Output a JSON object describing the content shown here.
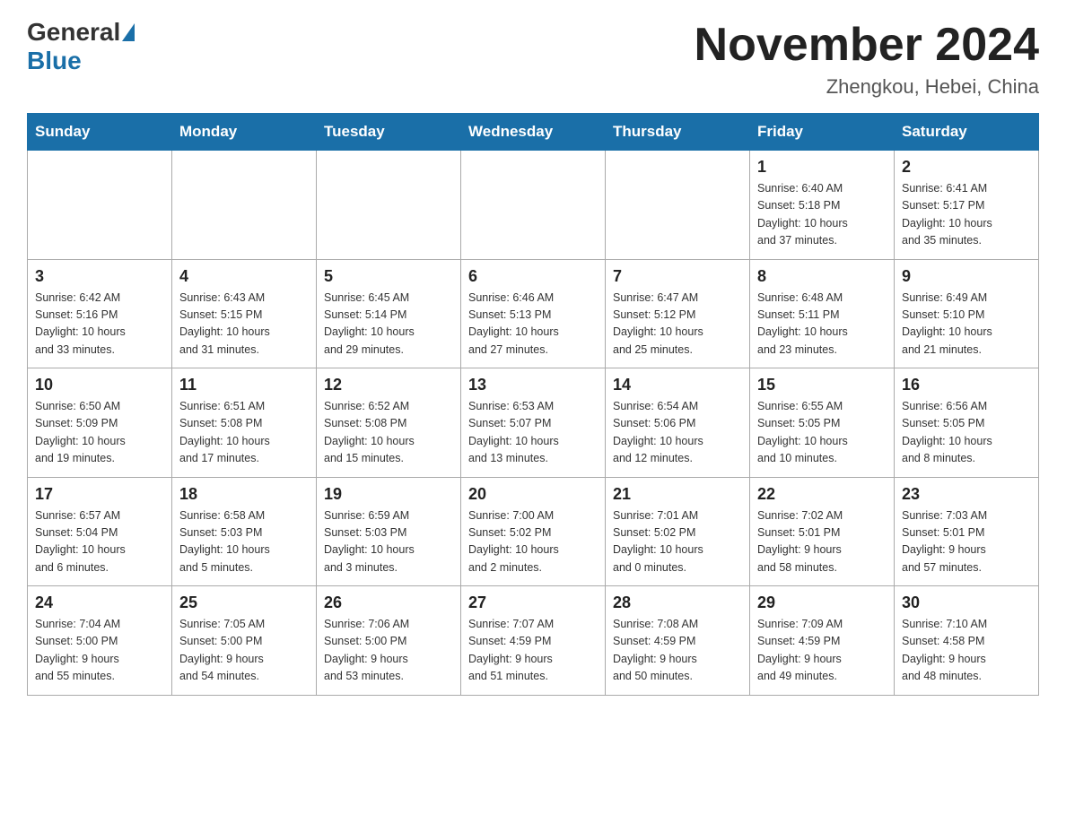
{
  "header": {
    "logo_general": "General",
    "logo_blue": "Blue",
    "month_year": "November 2024",
    "location": "Zhengkou, Hebei, China"
  },
  "weekdays": [
    "Sunday",
    "Monday",
    "Tuesday",
    "Wednesday",
    "Thursday",
    "Friday",
    "Saturday"
  ],
  "weeks": [
    [
      {
        "day": "",
        "info": ""
      },
      {
        "day": "",
        "info": ""
      },
      {
        "day": "",
        "info": ""
      },
      {
        "day": "",
        "info": ""
      },
      {
        "day": "",
        "info": ""
      },
      {
        "day": "1",
        "info": "Sunrise: 6:40 AM\nSunset: 5:18 PM\nDaylight: 10 hours\nand 37 minutes."
      },
      {
        "day": "2",
        "info": "Sunrise: 6:41 AM\nSunset: 5:17 PM\nDaylight: 10 hours\nand 35 minutes."
      }
    ],
    [
      {
        "day": "3",
        "info": "Sunrise: 6:42 AM\nSunset: 5:16 PM\nDaylight: 10 hours\nand 33 minutes."
      },
      {
        "day": "4",
        "info": "Sunrise: 6:43 AM\nSunset: 5:15 PM\nDaylight: 10 hours\nand 31 minutes."
      },
      {
        "day": "5",
        "info": "Sunrise: 6:45 AM\nSunset: 5:14 PM\nDaylight: 10 hours\nand 29 minutes."
      },
      {
        "day": "6",
        "info": "Sunrise: 6:46 AM\nSunset: 5:13 PM\nDaylight: 10 hours\nand 27 minutes."
      },
      {
        "day": "7",
        "info": "Sunrise: 6:47 AM\nSunset: 5:12 PM\nDaylight: 10 hours\nand 25 minutes."
      },
      {
        "day": "8",
        "info": "Sunrise: 6:48 AM\nSunset: 5:11 PM\nDaylight: 10 hours\nand 23 minutes."
      },
      {
        "day": "9",
        "info": "Sunrise: 6:49 AM\nSunset: 5:10 PM\nDaylight: 10 hours\nand 21 minutes."
      }
    ],
    [
      {
        "day": "10",
        "info": "Sunrise: 6:50 AM\nSunset: 5:09 PM\nDaylight: 10 hours\nand 19 minutes."
      },
      {
        "day": "11",
        "info": "Sunrise: 6:51 AM\nSunset: 5:08 PM\nDaylight: 10 hours\nand 17 minutes."
      },
      {
        "day": "12",
        "info": "Sunrise: 6:52 AM\nSunset: 5:08 PM\nDaylight: 10 hours\nand 15 minutes."
      },
      {
        "day": "13",
        "info": "Sunrise: 6:53 AM\nSunset: 5:07 PM\nDaylight: 10 hours\nand 13 minutes."
      },
      {
        "day": "14",
        "info": "Sunrise: 6:54 AM\nSunset: 5:06 PM\nDaylight: 10 hours\nand 12 minutes."
      },
      {
        "day": "15",
        "info": "Sunrise: 6:55 AM\nSunset: 5:05 PM\nDaylight: 10 hours\nand 10 minutes."
      },
      {
        "day": "16",
        "info": "Sunrise: 6:56 AM\nSunset: 5:05 PM\nDaylight: 10 hours\nand 8 minutes."
      }
    ],
    [
      {
        "day": "17",
        "info": "Sunrise: 6:57 AM\nSunset: 5:04 PM\nDaylight: 10 hours\nand 6 minutes."
      },
      {
        "day": "18",
        "info": "Sunrise: 6:58 AM\nSunset: 5:03 PM\nDaylight: 10 hours\nand 5 minutes."
      },
      {
        "day": "19",
        "info": "Sunrise: 6:59 AM\nSunset: 5:03 PM\nDaylight: 10 hours\nand 3 minutes."
      },
      {
        "day": "20",
        "info": "Sunrise: 7:00 AM\nSunset: 5:02 PM\nDaylight: 10 hours\nand 2 minutes."
      },
      {
        "day": "21",
        "info": "Sunrise: 7:01 AM\nSunset: 5:02 PM\nDaylight: 10 hours\nand 0 minutes."
      },
      {
        "day": "22",
        "info": "Sunrise: 7:02 AM\nSunset: 5:01 PM\nDaylight: 9 hours\nand 58 minutes."
      },
      {
        "day": "23",
        "info": "Sunrise: 7:03 AM\nSunset: 5:01 PM\nDaylight: 9 hours\nand 57 minutes."
      }
    ],
    [
      {
        "day": "24",
        "info": "Sunrise: 7:04 AM\nSunset: 5:00 PM\nDaylight: 9 hours\nand 55 minutes."
      },
      {
        "day": "25",
        "info": "Sunrise: 7:05 AM\nSunset: 5:00 PM\nDaylight: 9 hours\nand 54 minutes."
      },
      {
        "day": "26",
        "info": "Sunrise: 7:06 AM\nSunset: 5:00 PM\nDaylight: 9 hours\nand 53 minutes."
      },
      {
        "day": "27",
        "info": "Sunrise: 7:07 AM\nSunset: 4:59 PM\nDaylight: 9 hours\nand 51 minutes."
      },
      {
        "day": "28",
        "info": "Sunrise: 7:08 AM\nSunset: 4:59 PM\nDaylight: 9 hours\nand 50 minutes."
      },
      {
        "day": "29",
        "info": "Sunrise: 7:09 AM\nSunset: 4:59 PM\nDaylight: 9 hours\nand 49 minutes."
      },
      {
        "day": "30",
        "info": "Sunrise: 7:10 AM\nSunset: 4:58 PM\nDaylight: 9 hours\nand 48 minutes."
      }
    ]
  ]
}
